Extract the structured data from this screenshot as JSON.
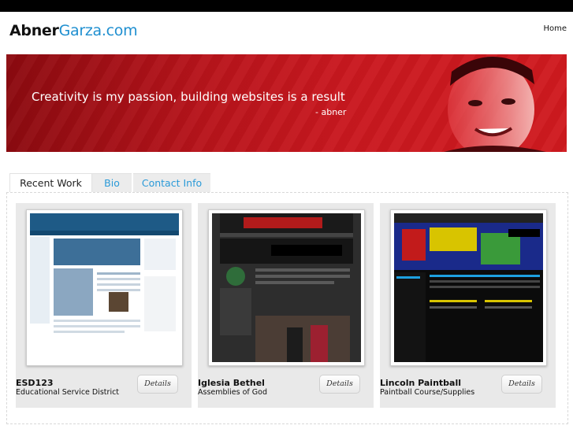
{
  "header": {
    "logo_first": "Abner",
    "logo_second": "Garza.com",
    "nav_home": "Home"
  },
  "banner": {
    "tagline": "Creativity is my passion, building websites is a result",
    "signature": "- abner"
  },
  "tabs": [
    {
      "label": "Recent Work"
    },
    {
      "label": "Bio"
    },
    {
      "label": "Contact Info"
    }
  ],
  "work": [
    {
      "title": "ESD123",
      "subtitle": "Educational Service District",
      "details_label": "Details"
    },
    {
      "title": "Iglesia Bethel",
      "subtitle": "Assemblies of God",
      "details_label": "Details"
    },
    {
      "title": "Lincoln Paintball",
      "subtitle": "Paintball Course/Supplies",
      "details_label": "Details"
    }
  ],
  "colors": {
    "accent": "#1f8fd0",
    "banner": "#c9181f",
    "topbar": "#000000"
  }
}
